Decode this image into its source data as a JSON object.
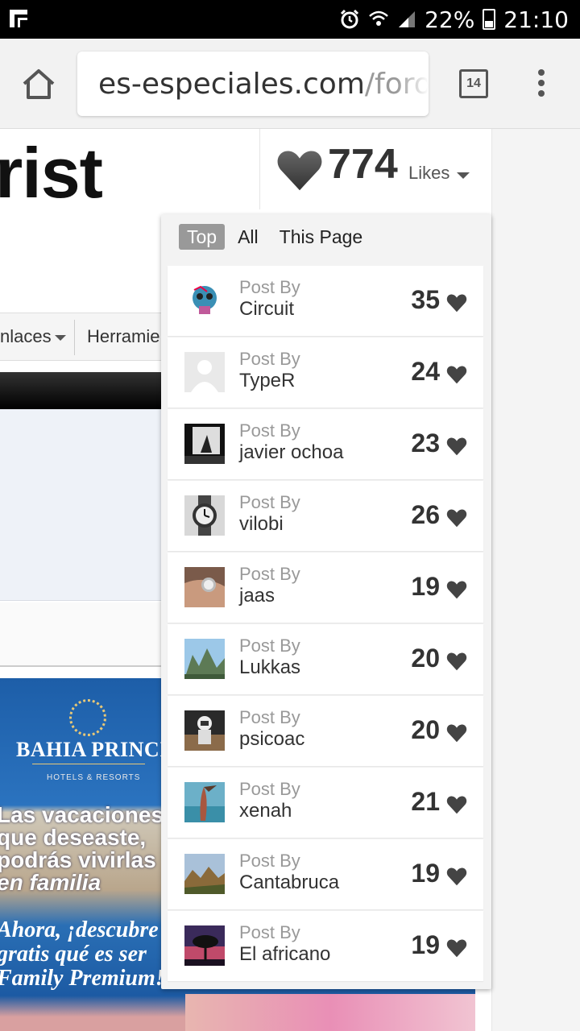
{
  "status_bar": {
    "battery": "22%",
    "time": "21:10"
  },
  "browser": {
    "url_host": "es-especiales.com",
    "url_path": "/foro",
    "tab_count": "14"
  },
  "page": {
    "title": "rist",
    "likes": {
      "count": "774",
      "label": "Likes"
    },
    "nav": {
      "item1": "nlaces",
      "item2": "Herramie"
    },
    "ad": {
      "brand": "BAHIA PRINCIPE",
      "sub": "HOTELS & RESORTS",
      "text1": [
        "Las vacaciones",
        "que deseaste,",
        "podrás vivirlas",
        "en familia"
      ],
      "text2": [
        "Ahora, ¡descubre",
        "gratis qué es ser",
        "Family Premium!"
      ]
    }
  },
  "popup": {
    "tabs": [
      "Top",
      "All",
      "This Page"
    ],
    "active_tab": "Top",
    "post_by_label": "Post By",
    "rows": [
      {
        "author": "Circuit",
        "count": "35",
        "avatar": "robot-skull-avatar"
      },
      {
        "author": "TypeR",
        "count": "24",
        "avatar": "default-avatar"
      },
      {
        "author": "javier ochoa",
        "count": "23",
        "avatar": "dark-photo-avatar"
      },
      {
        "author": "vilobi",
        "count": "26",
        "avatar": "watch-avatar"
      },
      {
        "author": "jaas",
        "count": "19",
        "avatar": "wrist-watch-avatar"
      },
      {
        "author": "Lukkas",
        "count": "20",
        "avatar": "mountain-avatar"
      },
      {
        "author": "psicoac",
        "count": "20",
        "avatar": "astronaut-avatar"
      },
      {
        "author": "xenah",
        "count": "21",
        "avatar": "beach-avatar"
      },
      {
        "author": "Cantabruca",
        "count": "19",
        "avatar": "landscape-avatar"
      },
      {
        "author": "El africano",
        "count": "19",
        "avatar": "sunset-tree-avatar"
      }
    ]
  },
  "colors": {
    "heart": "#444444",
    "active_tab": "#999999",
    "ad_blue": "#1d5ea8"
  }
}
